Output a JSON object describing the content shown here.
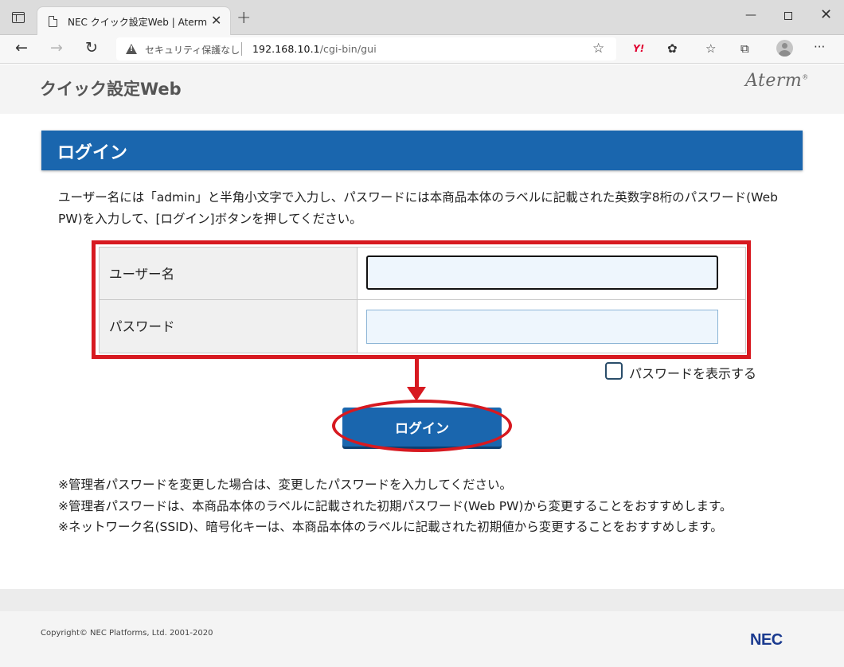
{
  "browser": {
    "tab_title": "NEC クイック設定Web | Aterm",
    "tab_close": "✕",
    "new_tab": "+",
    "minimize": "—",
    "maximize": "",
    "close": "✕",
    "security_text": "セキュリティ保護なし",
    "url_host": "192.168.10.1",
    "url_path": "/cgi-bin/gui",
    "back": "←",
    "forward": "→",
    "reload": "↻",
    "favorite_add": "☆",
    "yahoo": "Y!",
    "extensions": "✿",
    "favorites": "☆",
    "collections": "⧉",
    "more": "···"
  },
  "header": {
    "site_title": "クイック設定Web",
    "brand": "Aterm"
  },
  "login": {
    "banner_title": "ログイン",
    "instructions": "ユーザー名には「admin」と半角小文字で入力し、パスワードには本商品本体のラベルに記載された英数字8桁のパスワード(Web PW)を入力して、[ログイン]ボタンを押してください。",
    "username_label": "ユーザー名",
    "username_value": "",
    "password_label": "パスワード",
    "password_value": "",
    "show_password_label": "パスワードを表示する",
    "show_password_checked": false,
    "button_label": "ログイン"
  },
  "notes": [
    "※管理者パスワードを変更した場合は、変更したパスワードを入力してください。",
    "※管理者パスワードは、本商品本体のラベルに記載された初期パスワード(Web PW)から変更することをおすすめします。",
    "※ネットワーク名(SSID)、暗号化キーは、本商品本体のラベルに記載された初期値から変更することをおすすめします。"
  ],
  "footer": {
    "copyright": "Copyright© NEC Platforms, Ltd. 2001-2020",
    "logo": "NEC"
  },
  "colors": {
    "accent_blue": "#1a66ae",
    "annotation_red": "#d71920"
  }
}
